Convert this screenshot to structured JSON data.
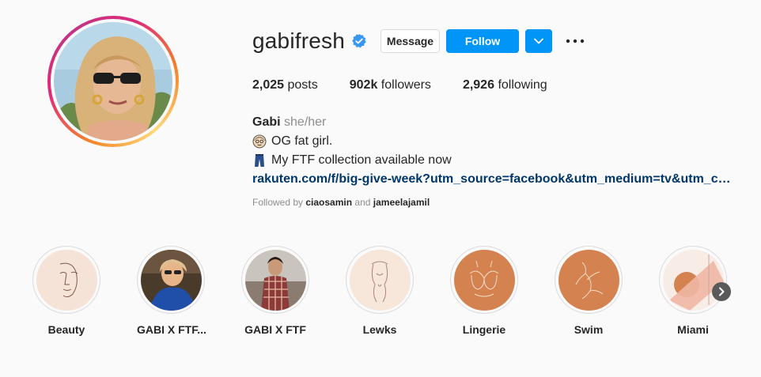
{
  "profile": {
    "username": "gabifresh",
    "verified": true,
    "buttons": {
      "message": "Message",
      "follow": "Follow"
    },
    "stats": {
      "posts_count": "2,025",
      "posts_label": "posts",
      "followers_count": "902k",
      "followers_label": "followers",
      "following_count": "2,926",
      "following_label": "following"
    },
    "bio": {
      "name": "Gabi",
      "pronouns": "she/her",
      "line1": "OG fat girl.",
      "line2": "My FTF collection available now",
      "link": "rakuten.com/f/big-give-week?utm_source=facebook&utm_medium=tv&utm_cam…"
    },
    "followed_by": {
      "prefix": "Followed by",
      "user1": "ciaosamin",
      "conjunction": "and",
      "user2": "jameelajamil"
    }
  },
  "highlights": [
    {
      "label": "Beauty"
    },
    {
      "label": "GABI X FTF..."
    },
    {
      "label": "GABI X FTF"
    },
    {
      "label": "Lewks"
    },
    {
      "label": "Lingerie"
    },
    {
      "label": "Swim"
    },
    {
      "label": "Miami"
    }
  ],
  "colors": {
    "accent": "#0095f6",
    "link": "#00376b",
    "muted": "#8e8e8e",
    "highlight_terracotta": "#d4824f"
  }
}
